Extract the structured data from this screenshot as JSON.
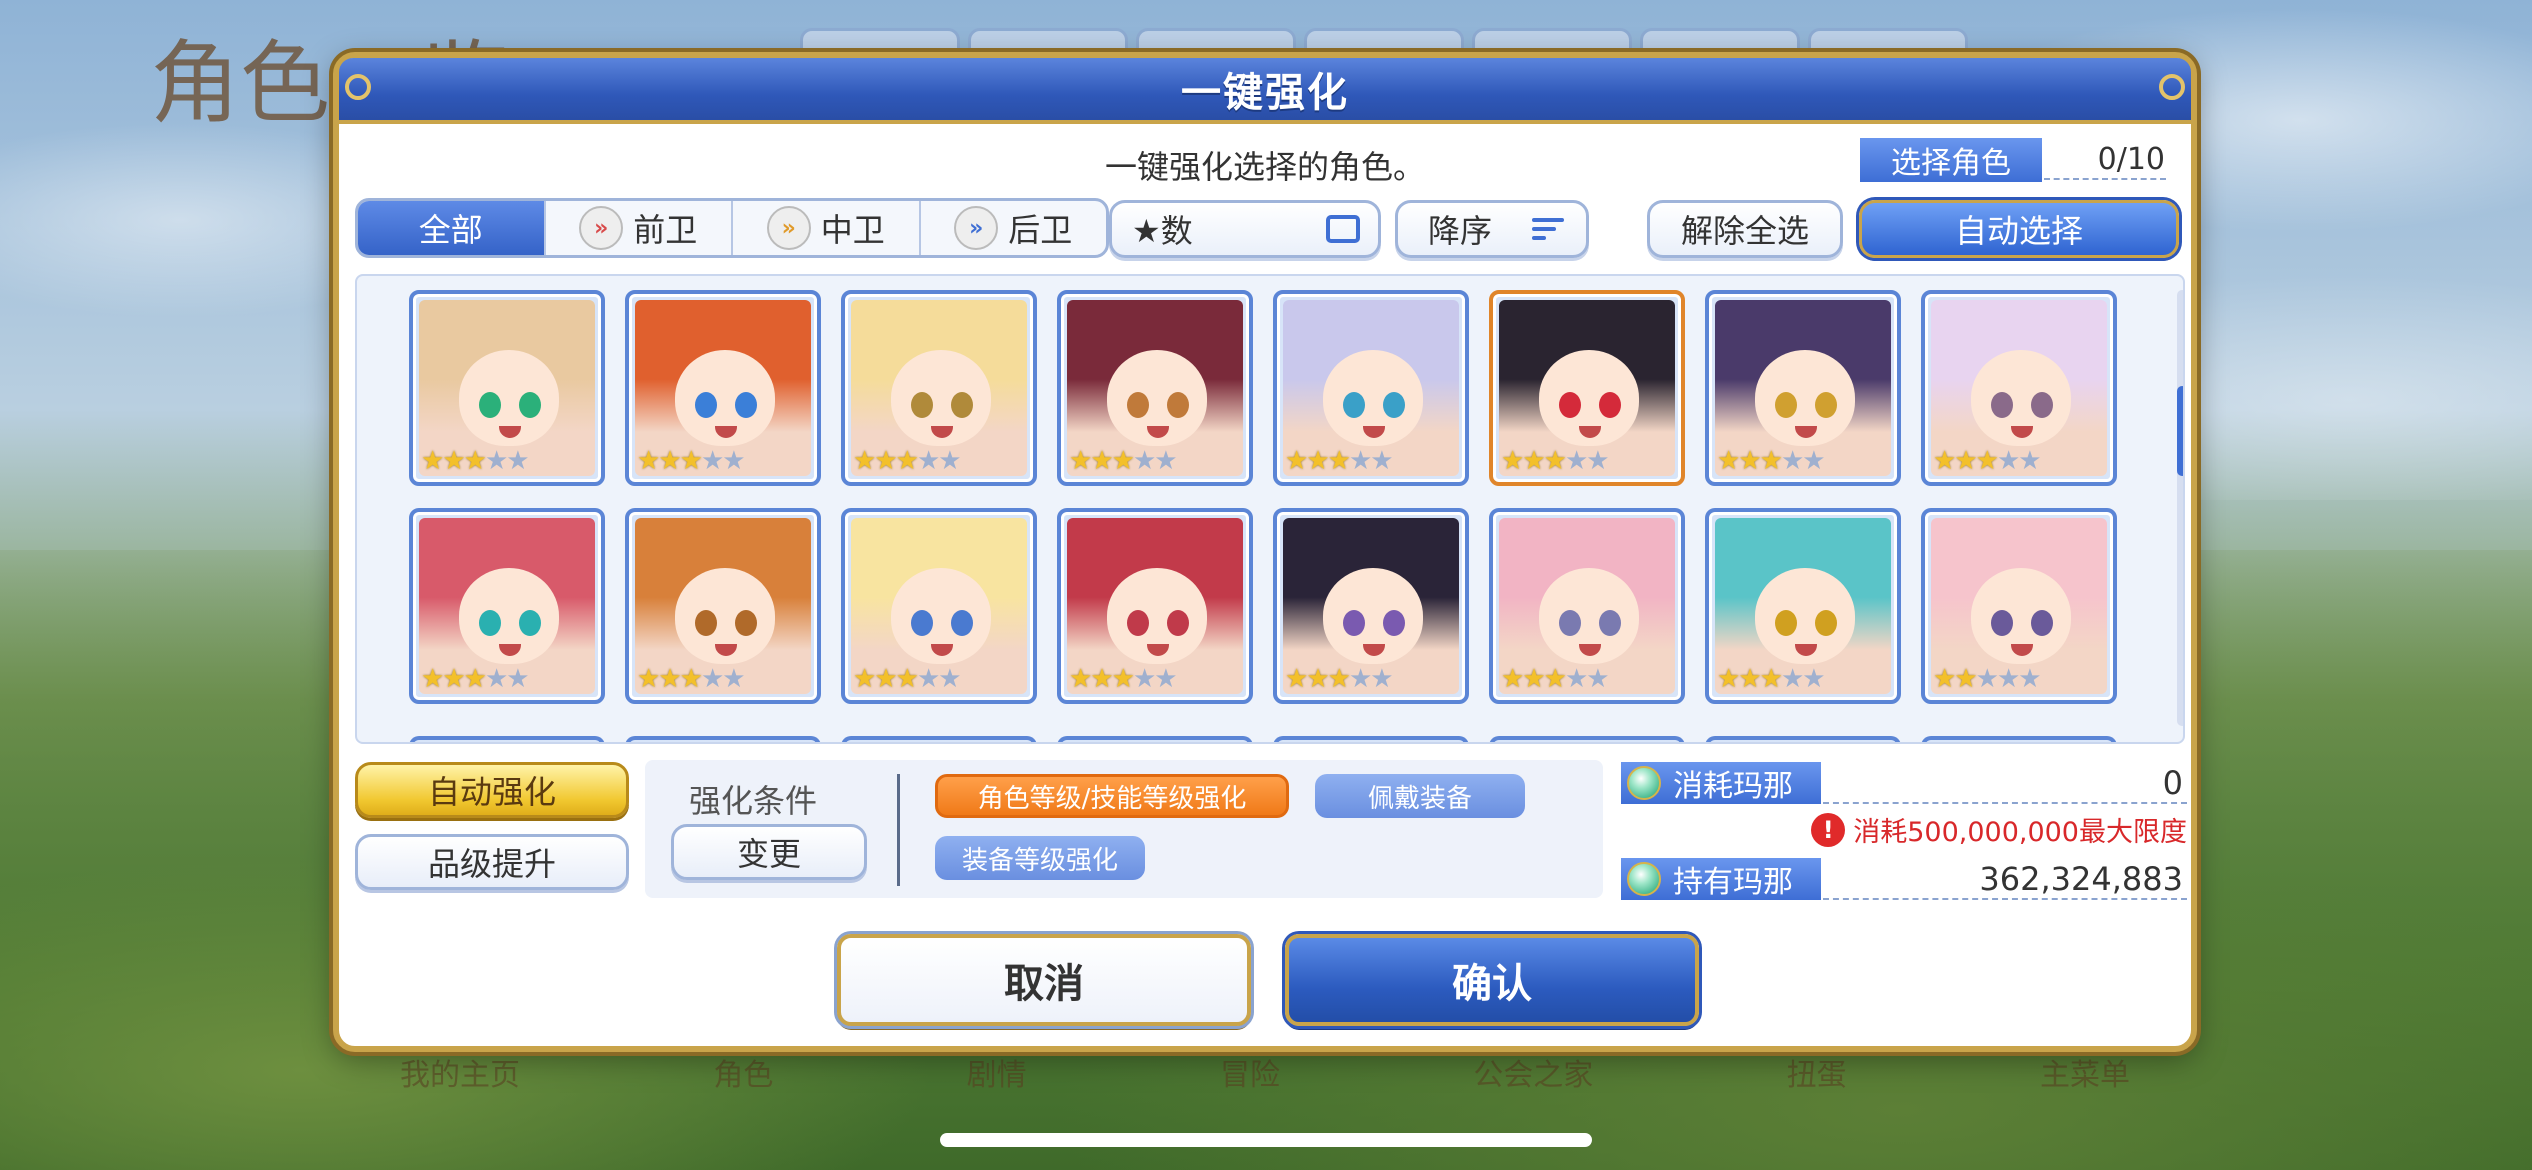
{
  "background": {
    "title": "角色一览",
    "nav": [
      "我的主页",
      "角色",
      "剧情",
      "冒险",
      "公会之家",
      "扭蛋",
      "主菜单"
    ]
  },
  "dialog": {
    "title": "一键强化",
    "subtitle": "一键强化选择的角色。",
    "select_label": "选择角色",
    "select_count": "0/10"
  },
  "filters": {
    "tabs": [
      {
        "label": "全部",
        "icon": "",
        "active": true
      },
      {
        "label": "前卫",
        "icon": "vanguard-icon",
        "active": false
      },
      {
        "label": "中卫",
        "icon": "midguard-icon",
        "active": false
      },
      {
        "label": "后卫",
        "icon": "rearguard-icon",
        "active": false
      }
    ],
    "sort_field": "★数",
    "sort_order": "降序",
    "clear_all": "解除全选",
    "auto_select": "自动选择"
  },
  "roster": {
    "cards": [
      {
        "stars": 3,
        "max": 5,
        "hair": "#e9c9a0",
        "eyes": "#2bb07a",
        "selected": false
      },
      {
        "stars": 3,
        "max": 5,
        "hair": "#e0602e",
        "eyes": "#3b7fd8",
        "selected": false
      },
      {
        "stars": 3,
        "max": 5,
        "hair": "#f5dc9a",
        "eyes": "#b08a3a",
        "selected": false
      },
      {
        "stars": 3,
        "max": 5,
        "hair": "#7a2a3a",
        "eyes": "#c07a3a",
        "selected": false
      },
      {
        "stars": 3,
        "max": 5,
        "hair": "#c9c8ec",
        "eyes": "#3aa0c8",
        "selected": false
      },
      {
        "stars": 3,
        "max": 5,
        "hair": "#2a2430",
        "eyes": "#d42a3a",
        "selected": true
      },
      {
        "stars": 3,
        "max": 5,
        "hair": "#4a3a6a",
        "eyes": "#d0a030",
        "selected": false
      },
      {
        "stars": 3,
        "max": 5,
        "hair": "#e8d4f0",
        "eyes": "#8a6a8a",
        "selected": false
      },
      {
        "stars": 3,
        "max": 5,
        "hair": "#d85a6a",
        "eyes": "#2ab0b0",
        "selected": false
      },
      {
        "stars": 3,
        "max": 5,
        "hair": "#d8803a",
        "eyes": "#b06a2a",
        "selected": false
      },
      {
        "stars": 3,
        "max": 5,
        "hair": "#f8e4a0",
        "eyes": "#4a7ad0",
        "selected": false
      },
      {
        "stars": 3,
        "max": 5,
        "hair": "#c23a4a",
        "eyes": "#c03a4a",
        "selected": false
      },
      {
        "stars": 3,
        "max": 5,
        "hair": "#2a2438",
        "eyes": "#7a5ab0",
        "selected": false
      },
      {
        "stars": 3,
        "max": 5,
        "hair": "#f2b4c4",
        "eyes": "#7a7ab0",
        "selected": false
      },
      {
        "stars": 3,
        "max": 5,
        "hair": "#5ac4c8",
        "eyes": "#d0a020",
        "selected": false
      },
      {
        "stars": 2,
        "max": 5,
        "hair": "#f6c4cc",
        "eyes": "#6a5a9a",
        "selected": false
      }
    ]
  },
  "actions": {
    "auto_enhance": "自动强化",
    "rank_up": "品级提升",
    "condition_label": "强化条件",
    "change": "变更",
    "tag_level": "角色等级/技能等级强化",
    "tag_equip": "佩戴装备",
    "tag_equip_level": "装备等级强化"
  },
  "mana": {
    "cost_label": "消耗玛那",
    "cost_value": "0",
    "warning": "消耗500,000,000最大限度",
    "owned_label": "持有玛那",
    "owned_value": "362,324,883"
  },
  "footer": {
    "cancel": "取消",
    "confirm": "确认"
  }
}
